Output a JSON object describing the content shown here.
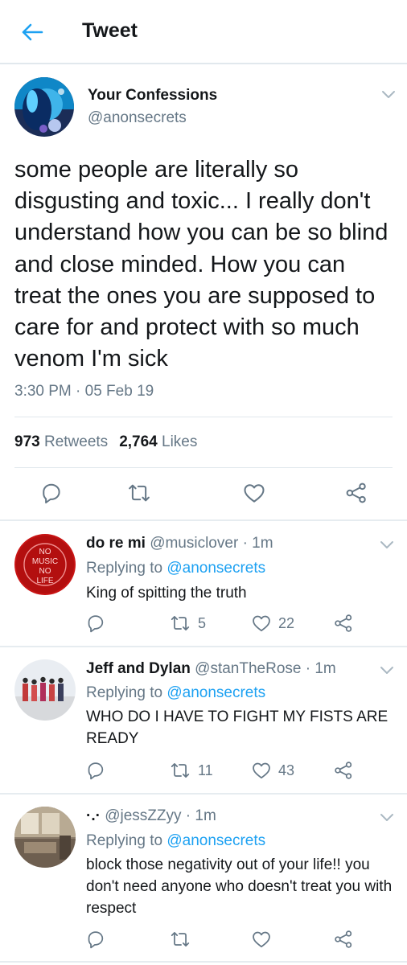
{
  "header": {
    "title": "Tweet",
    "back_icon": "arrow-left-icon",
    "accent": "#1da1f2"
  },
  "tweet": {
    "author_name": "Your Confessions",
    "author_handle": "@anonsecrets",
    "text": "some people are literally so disgusting and toxic... I really don't understand how you can be so blind and close minded. How you can treat the ones you are supposed to care for and protect with so much venom I'm sick",
    "timestamp": "3:30 PM · 05 Feb 19",
    "retweets_count": "973",
    "retweets_label": "Retweets",
    "likes_count": "2,764",
    "likes_label": "Likes",
    "actions": [
      "reply-icon",
      "retweet-icon",
      "like-icon",
      "share-icon"
    ]
  },
  "replies": [
    {
      "name": "do re mi",
      "handle": "@musiclover",
      "time": "· 1m",
      "replying_prefix": "Replying to",
      "replying_to": "@anonsecrets",
      "text": "King of spitting the truth",
      "retweets": "5",
      "likes": "22",
      "avatar_text": [
        "NO",
        "MUSIC",
        "NO",
        "LIFE"
      ]
    },
    {
      "name": "Jeff and Dylan",
      "handle": "@stanTheRose",
      "time": "· 1m",
      "replying_prefix": "Replying to",
      "replying_to": "@anonsecrets",
      "text": "WHO DO I HAVE TO FIGHT MY FISTS ARE READY",
      "retweets": "11",
      "likes": "43"
    },
    {
      "name": "·.·",
      "handle": "@jessZZyy",
      "time": "· 1m",
      "replying_prefix": "Replying to",
      "replying_to": "@anonsecrets",
      "text": "block those negativity out of your life!! you don't need anyone who doesn't treat you with respect",
      "retweets": "",
      "likes": ""
    }
  ],
  "colors": {
    "text": "#14171a",
    "secondary": "#657786",
    "link": "#1da1f2",
    "divider": "#e1e8ed"
  }
}
